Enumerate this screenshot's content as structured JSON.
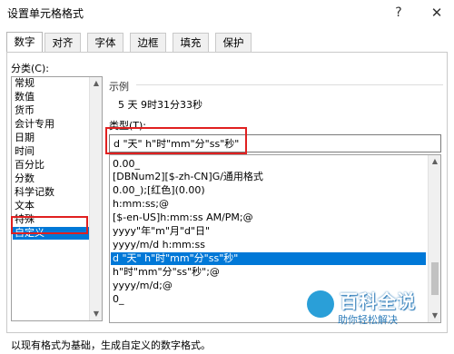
{
  "dialog": {
    "title": "设置单元格格式",
    "help_glyph": "?",
    "close_glyph": "✕"
  },
  "tabs": [
    {
      "label": "数字",
      "active": true
    },
    {
      "label": "对齐",
      "active": false
    },
    {
      "label": "字体",
      "active": false
    },
    {
      "label": "边框",
      "active": false
    },
    {
      "label": "填充",
      "active": false
    },
    {
      "label": "保护",
      "active": false
    }
  ],
  "category": {
    "label": "分类(C):",
    "items": [
      "常规",
      "数值",
      "货币",
      "会计专用",
      "日期",
      "时间",
      "百分比",
      "分数",
      "科学记数",
      "文本",
      "特殊",
      "自定义"
    ],
    "selected": "自定义"
  },
  "sample": {
    "label": "示例",
    "value": "5 天 9时31分33秒"
  },
  "type": {
    "label": "类型(T):",
    "value": "d \"天\" h\"时\"mm\"分\"ss\"秒\""
  },
  "format_list": {
    "items": [
      "0.00_",
      "[DBNum2][$-zh-CN]G/通用格式",
      "0.00_);[红色](0.00)",
      "h:mm:ss;@",
      "[$-en-US]h:mm:ss AM/PM;@",
      "yyyy\"年\"m\"月\"d\"日\"",
      "yyyy/m/d h:mm:ss",
      "d \"天\" h\"时\"mm\"分\"ss\"秒\"",
      "h\"时\"mm\"分\"ss\"秒\";@",
      "yyyy/m/d;@",
      "0_"
    ],
    "selected": "d \"天\" h\"时\"mm\"分\"ss\"秒\""
  },
  "hint": "以现有格式为基础，生成自定义的数字格式。",
  "watermark": {
    "main": "百科全说",
    "sub": "助你轻松解决"
  },
  "scroll_glyphs": {
    "up": "▲",
    "down": "▼"
  },
  "colors": {
    "selection": "#0078d7",
    "highlight_box": "#e02020"
  }
}
